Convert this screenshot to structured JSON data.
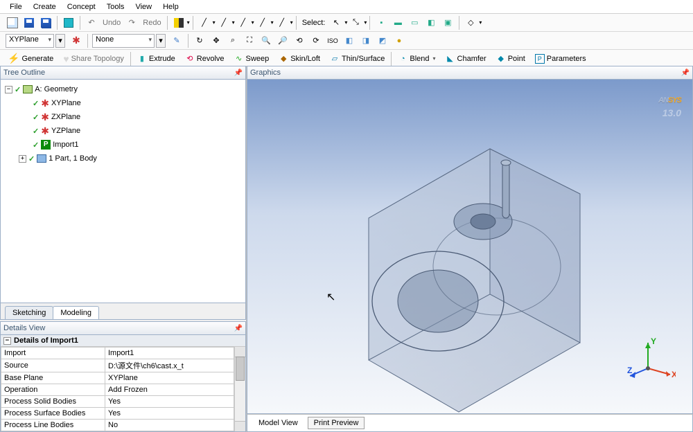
{
  "menu": [
    "File",
    "Create",
    "Concept",
    "Tools",
    "View",
    "Help"
  ],
  "undo": "Undo",
  "redo": "Redo",
  "select_label": "Select:",
  "plane_dd": "XYPlane",
  "sketch_dd": "None",
  "ops": {
    "generate": "Generate",
    "share": "Share Topology",
    "extrude": "Extrude",
    "revolve": "Revolve",
    "sweep": "Sweep",
    "skin": "Skin/Loft",
    "thin": "Thin/Surface",
    "blend": "Blend",
    "chamfer": "Chamfer",
    "point": "Point",
    "params": "Parameters"
  },
  "panels": {
    "tree": "Tree Outline",
    "graphics": "Graphics",
    "details": "Details View"
  },
  "tree": {
    "root": "A: Geometry",
    "xy": "XYPlane",
    "zx": "ZXPlane",
    "yz": "YZPlane",
    "import": "Import1",
    "parts": "1 Part, 1 Body"
  },
  "tabs": {
    "sketching": "Sketching",
    "modeling": "Modeling"
  },
  "details": {
    "header": "Details of Import1",
    "rows": [
      [
        "Import",
        "Import1"
      ],
      [
        "Source",
        "D:\\源文件\\ch6\\cast.x_t"
      ],
      [
        "Base Plane",
        "XYPlane"
      ],
      [
        "Operation",
        "Add Frozen"
      ],
      [
        "Process Solid Bodies",
        "Yes"
      ],
      [
        "Process Surface Bodies",
        "Yes"
      ],
      [
        "Process Line Bodies",
        "No"
      ]
    ]
  },
  "logo": {
    "brand_pre": "AN",
    "brand_em": "SYS",
    "ver": "13.0"
  },
  "axes": {
    "x": "X",
    "y": "Y",
    "z": "Z"
  },
  "bottomtabs": {
    "model": "Model View",
    "print": "Print Preview"
  }
}
